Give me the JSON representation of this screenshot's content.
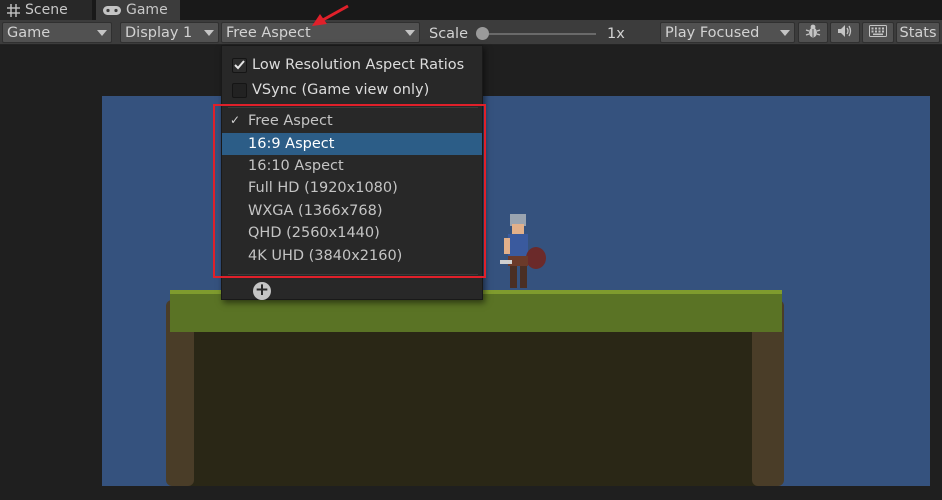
{
  "tabs": [
    {
      "label": "Scene",
      "icon": "grid-icon"
    },
    {
      "label": "Game",
      "icon": "gamepad-icon"
    }
  ],
  "toolbar": {
    "view_dropdown": "Game",
    "display_dropdown": "Display 1",
    "aspect_dropdown": "Free Aspect",
    "scale_label": "Scale",
    "scale_value": "1x",
    "play_mode_dropdown": "Play Focused",
    "stats_label": "Stats"
  },
  "aspect_menu": {
    "toggles": [
      {
        "label": "Low Resolution Aspect Ratios",
        "checked": true
      },
      {
        "label": "VSync (Game view only)",
        "checked": false
      }
    ],
    "options": [
      {
        "label": "Free Aspect",
        "checked": true
      },
      {
        "label": "16:9 Aspect",
        "highlighted": true
      },
      {
        "label": "16:10 Aspect"
      },
      {
        "label": "Full HD (1920x1080)"
      },
      {
        "label": "WXGA (1366x768)"
      },
      {
        "label": "QHD (2560x1440)"
      },
      {
        "label": "4K UHD (3840x2160)"
      }
    ],
    "tick_glyph": "✓",
    "add_glyph": "+"
  },
  "colors": {
    "sky": "#35527e",
    "selection": "#2c5d87",
    "annotation": "#e0202a"
  }
}
